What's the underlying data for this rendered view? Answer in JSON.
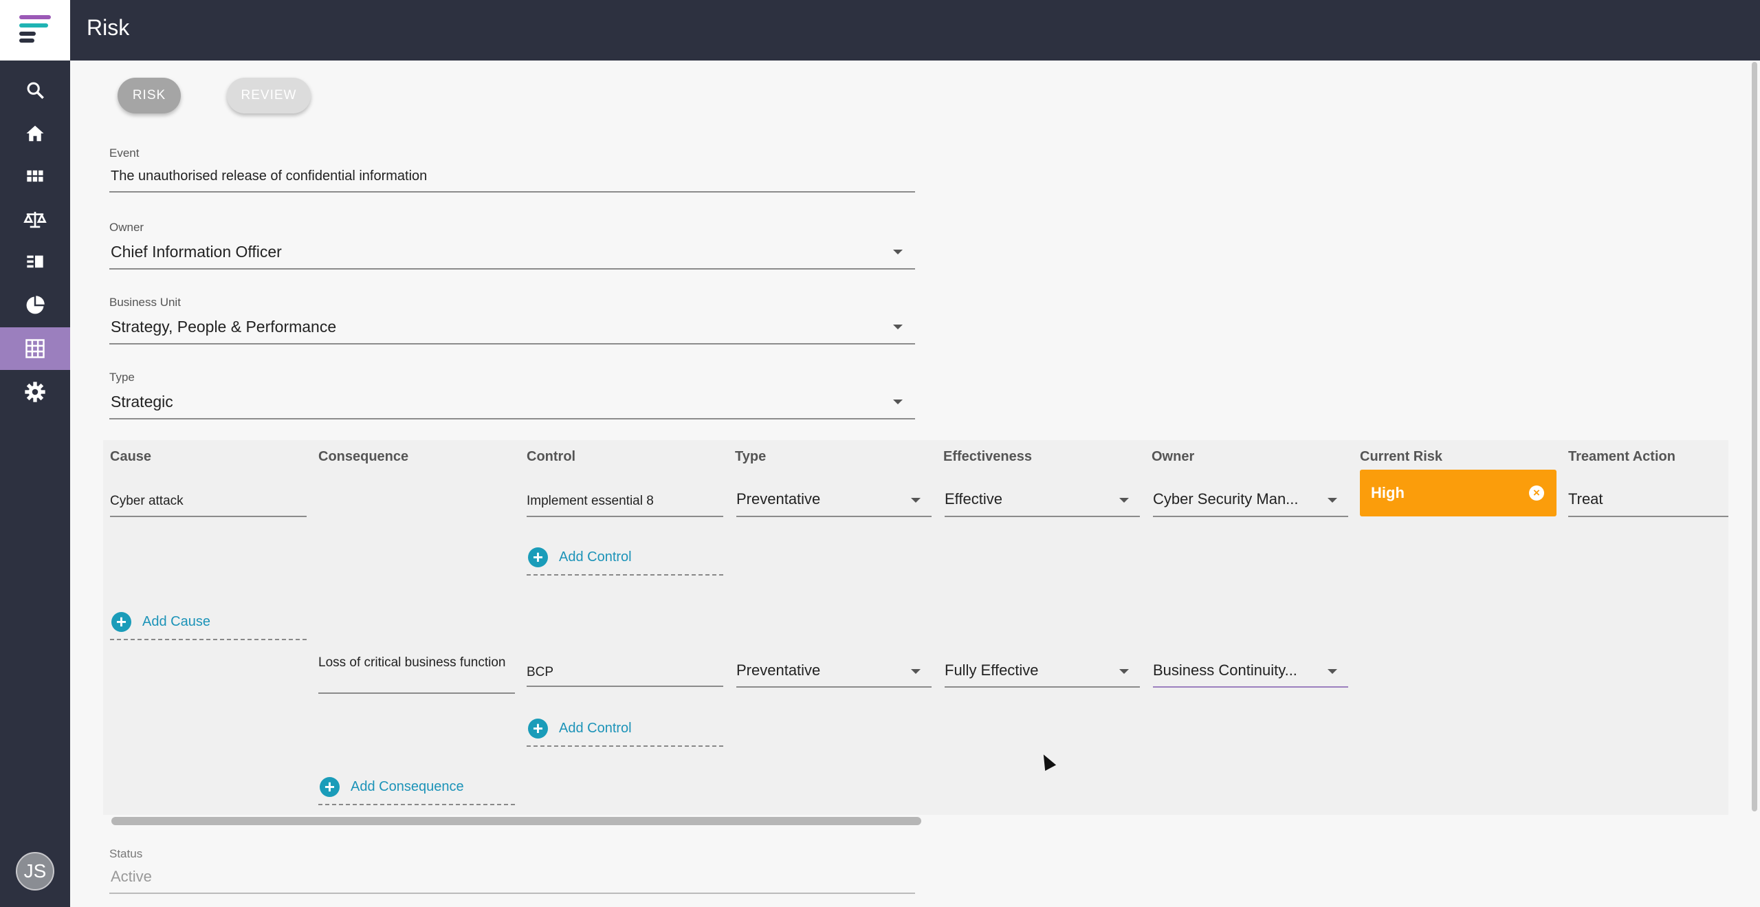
{
  "app": {
    "title": "Risk",
    "brand_colors": {
      "purple": "#9b59b6",
      "teal": "#1fb3b3",
      "dark": "#2d3140",
      "accent": "#9b7fbe"
    }
  },
  "sidebar": {
    "items": [
      {
        "icon": "search-icon"
      },
      {
        "icon": "home-icon"
      },
      {
        "icon": "grid-icon"
      },
      {
        "icon": "balance-scale-icon"
      },
      {
        "icon": "list-icon"
      },
      {
        "icon": "pie-chart-icon"
      },
      {
        "icon": "table-icon",
        "active": true
      },
      {
        "icon": "settings-icon"
      }
    ],
    "avatar": "JS"
  },
  "tabs": {
    "risk": "RISK",
    "review": "REVIEW"
  },
  "form": {
    "event": {
      "label": "Event",
      "value": "The unauthorised release of confidential information"
    },
    "owner": {
      "label": "Owner",
      "value": "Chief Information Officer"
    },
    "business_unit": {
      "label": "Business Unit",
      "value": "Strategy, People & Performance"
    },
    "type": {
      "label": "Type",
      "value": "Strategic"
    },
    "status": {
      "label": "Status",
      "value": "Active"
    }
  },
  "grid": {
    "headers": {
      "cause": "Cause",
      "consequence": "Consequence",
      "control": "Control",
      "type": "Type",
      "effectiveness": "Effectiveness",
      "owner": "Owner",
      "current_risk": "Current Risk",
      "treatment_action": "Treament Action"
    },
    "row1": {
      "cause": "Cyber attack",
      "control": "Implement essential 8",
      "type": "Preventative",
      "effectiveness": "Effective",
      "owner": "Cyber Security Man...",
      "current_risk": "High",
      "current_risk_color": "#fb9d0b",
      "treatment_action": "Treat"
    },
    "row2": {
      "consequence": "Loss of critical business function",
      "control": "BCP",
      "type": "Preventative",
      "effectiveness": "Fully Effective",
      "owner": "Business Continuity..."
    },
    "add_control": "Add Control",
    "add_cause": "Add Cause",
    "add_consequence": "Add Consequence"
  }
}
